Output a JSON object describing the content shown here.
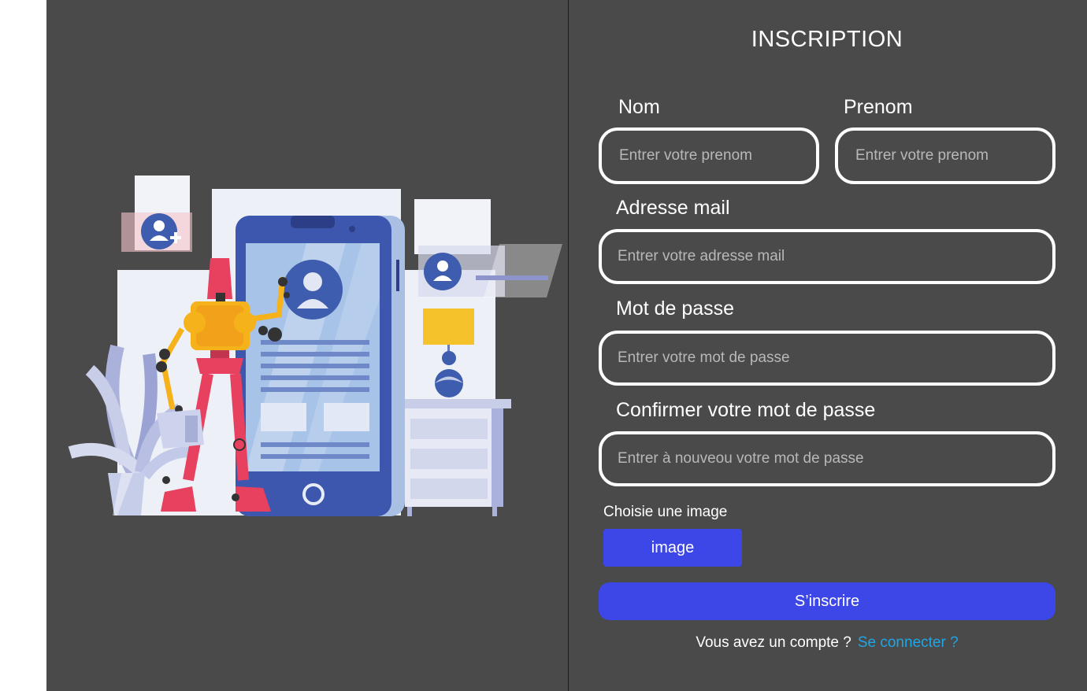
{
  "form": {
    "title": "INSCRIPTION",
    "nom_label": "Nom",
    "nom_placeholder": "Entrer votre prenom",
    "prenom_label": "Prenom",
    "prenom_placeholder": "Entrer votre prenom",
    "email_label": "Adresse mail",
    "email_placeholder": "Entrer votre adresse mail",
    "password_label": "Mot de passe",
    "password_placeholder": "Entrer votre mot de passe",
    "confirm_label": "Confirmer votre mot de passe",
    "confirm_placeholder": "Entrer à nouveou votre mot de passe",
    "image_label": "Choisie une image",
    "image_button": "image",
    "submit_button": "S’inscrire",
    "footer_text": "Vous avez un compte ?",
    "footer_link": "Se connecter ?"
  },
  "colors": {
    "background": "#4a4a4a",
    "primary": "#3d47e8",
    "link": "#1ea6e6",
    "border": "#ffffff"
  },
  "illustration": {
    "icons": [
      "robot-icon",
      "phone-icon",
      "plant-icon",
      "user-avatar-icon",
      "lamp-icon",
      "dresser-icon"
    ]
  }
}
